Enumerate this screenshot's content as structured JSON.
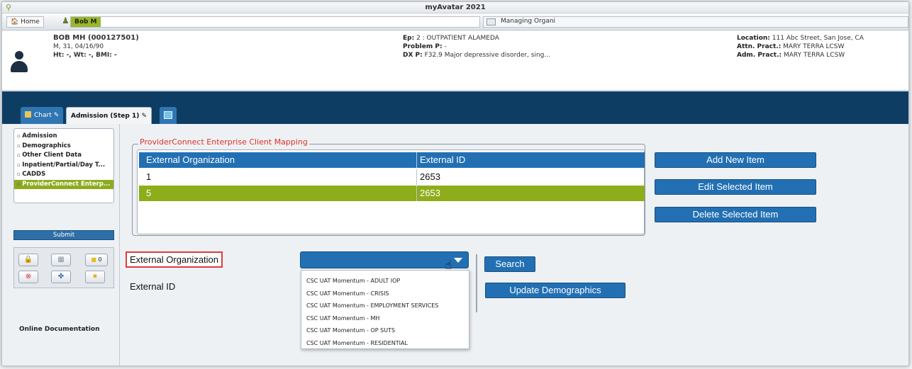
{
  "window": {
    "title": "myAvatar 2021"
  },
  "tabs": {
    "home": "Home",
    "client": "Bob M",
    "form": "Managing Organi"
  },
  "patient": {
    "name": "BOB MH (000127501)",
    "demo": "M, 31, 04/16/90",
    "vitals": "Ht: -, Wt: -, BMI: -",
    "episode_label": "Ep:",
    "episode": "2 : OUTPATIENT ALAMEDA",
    "problem_label": "Problem P:",
    "problem": "-",
    "dx_label": "DX P:",
    "dx": "F32.9 Major depressive disorder, sing...",
    "location_label": "Location:",
    "location": "111 Abc Street, San Jose, CA",
    "attn_label": "Attn. Pract.:",
    "attn": "MARY TERRA LCSW",
    "adm_label": "Adm. Pract.:",
    "adm": "MARY TERRA LCSW"
  },
  "page_tabs": {
    "chart": "Chart",
    "admission": "Admission (Step 1)"
  },
  "sidebar": {
    "items": [
      {
        "label": "Admission"
      },
      {
        "label": "Demographics"
      },
      {
        "label": "Other Client Data"
      },
      {
        "label": "Inpatient/Partial/Day T..."
      },
      {
        "label": "CADDS"
      },
      {
        "label": "ProviderConnect Enterp..."
      }
    ],
    "submit": "Submit",
    "notes_count": "0",
    "online_doc": "Online Documentation"
  },
  "mapping": {
    "title": "ProviderConnect Enterprise Client Mapping",
    "columns": [
      "External Organization",
      "External ID"
    ],
    "rows": [
      {
        "org": "1",
        "id": "2653"
      },
      {
        "org": "5",
        "id": "2653"
      }
    ]
  },
  "actions": {
    "add": "Add New Item",
    "edit": "Edit Selected Item",
    "delete": "Delete Selected Item"
  },
  "form": {
    "ext_org_label": "External Organization",
    "ext_id_label": "External ID",
    "search": "Search",
    "update": "Update Demographics",
    "options": [
      "CSC UAT Momentum - ADULT IOP",
      "CSC UAT Momentum - CRISIS",
      "CSC UAT Momentum - EMPLOYMENT SERVICES",
      "CSC UAT Momentum - MH",
      "CSC UAT Momentum - OP SUTS",
      "CSC UAT Momentum - RESIDENTIAL"
    ]
  }
}
